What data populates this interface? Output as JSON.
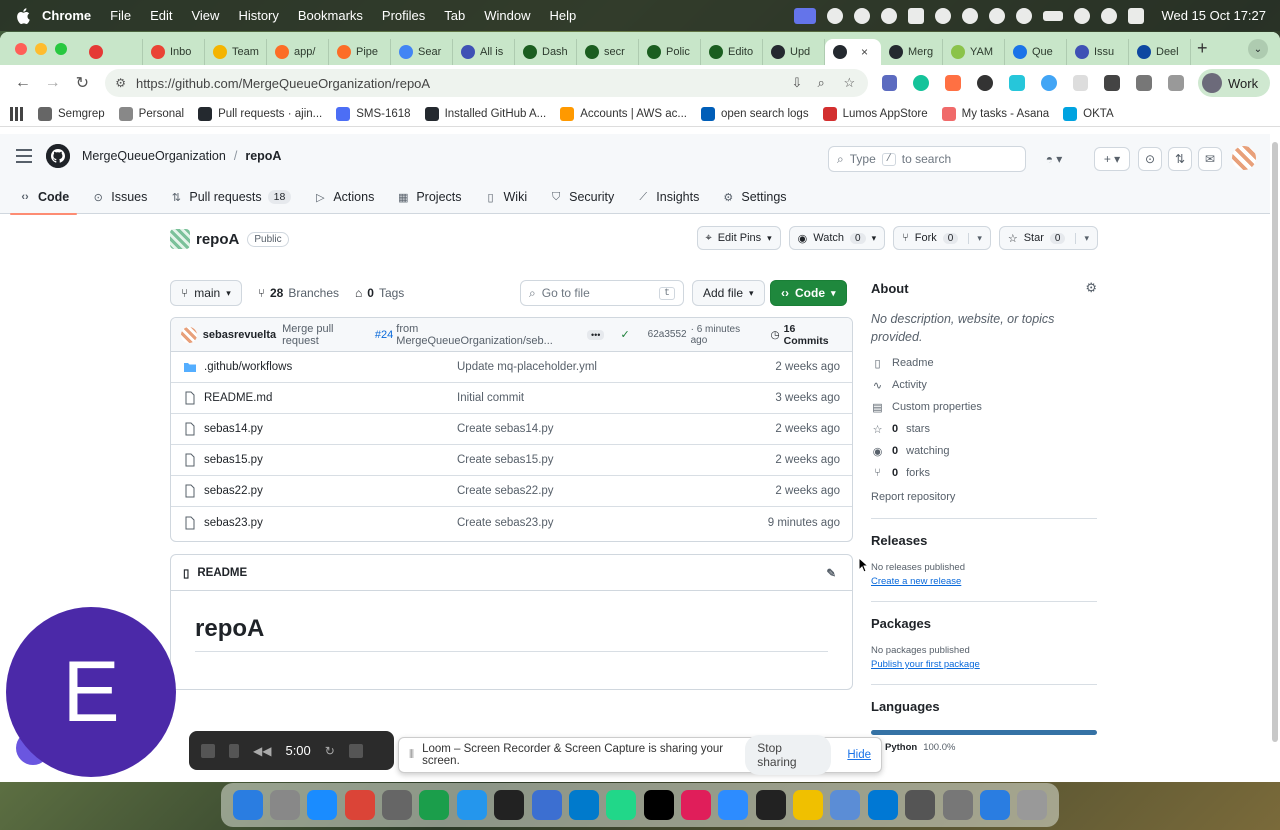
{
  "menubar": {
    "items": [
      "Chrome",
      "File",
      "Edit",
      "View",
      "History",
      "Bookmarks",
      "Profiles",
      "Tab",
      "Window",
      "Help"
    ],
    "clock": "Wed 15 Oct  17:27"
  },
  "tabs": [
    {
      "label": "",
      "color": "#e53935"
    },
    {
      "label": "Inbo",
      "color": "#ea4335"
    },
    {
      "label": "Team",
      "color": "#f4b400"
    },
    {
      "label": "app/",
      "color": "#fc6d26"
    },
    {
      "label": "Pipe",
      "color": "#fc6d26"
    },
    {
      "label": "Sear",
      "color": "#4285f4"
    },
    {
      "label": "All is",
      "color": "#3f51b5"
    },
    {
      "label": "Dash",
      "color": "#1b5e20"
    },
    {
      "label": "secr",
      "color": "#1b5e20"
    },
    {
      "label": "Polic",
      "color": "#1b5e20"
    },
    {
      "label": "Edito",
      "color": "#1b5e20"
    },
    {
      "label": "Upd",
      "color": "#24292f"
    },
    {
      "label": "",
      "color": "#24292f",
      "active": true
    },
    {
      "label": "Merg",
      "color": "#24292f"
    },
    {
      "label": "YAM",
      "color": "#8bc34a"
    },
    {
      "label": "Que",
      "color": "#1a73e8"
    },
    {
      "label": "Issu",
      "color": "#3f51b5"
    },
    {
      "label": "Deel",
      "color": "#0d47a1"
    }
  ],
  "browser": {
    "url": "https://github.com/MergeQueueOrganization/repoA",
    "profile": "Work"
  },
  "bookmarks": [
    {
      "label": "Semgrep",
      "color": "#666"
    },
    {
      "label": "Personal",
      "color": "#888"
    },
    {
      "label": "Pull requests · ajin...",
      "color": "#24292f"
    },
    {
      "label": "SMS-1618",
      "color": "#4c6ef5"
    },
    {
      "label": "Installed GitHub A...",
      "color": "#24292f"
    },
    {
      "label": "Accounts | AWS ac...",
      "color": "#ff9900"
    },
    {
      "label": "open search logs",
      "color": "#005eb8"
    },
    {
      "label": "Lumos AppStore",
      "color": "#d32f2f"
    },
    {
      "label": "My tasks - Asana",
      "color": "#f06a6a"
    },
    {
      "label": "OKTA",
      "color": "#00a3e0"
    }
  ],
  "github": {
    "org": "MergeQueueOrganization",
    "repo": "repoA",
    "search_placeholder_a": "Type",
    "search_key": "/",
    "search_placeholder_b": "to search",
    "nav": [
      {
        "label": "Code",
        "icon": "code-icon",
        "selected": true
      },
      {
        "label": "Issues",
        "icon": "issue-icon"
      },
      {
        "label": "Pull requests",
        "icon": "pull-request-icon",
        "count": "18"
      },
      {
        "label": "Actions",
        "icon": "play-icon"
      },
      {
        "label": "Projects",
        "icon": "table-icon"
      },
      {
        "label": "Wiki",
        "icon": "book-icon"
      },
      {
        "label": "Security",
        "icon": "shield-icon"
      },
      {
        "label": "Insights",
        "icon": "graph-icon"
      },
      {
        "label": "Settings",
        "icon": "gear-icon"
      }
    ],
    "visibility": "Public",
    "actions": {
      "edit_pins": "Edit Pins",
      "watch": "Watch",
      "watch_count": "0",
      "fork": "Fork",
      "fork_count": "0",
      "star": "Star",
      "star_count": "0"
    },
    "branch": "main",
    "branches_count": "28",
    "branches_label": "Branches",
    "tags_count": "0",
    "tags_label": "Tags",
    "go_to_file": "Go to file",
    "go_to_file_key": "t",
    "add_file": "Add file",
    "code_button": "Code",
    "commit": {
      "author": "sebasrevuelta",
      "msg_a": "Merge pull request",
      "pr": "#24",
      "msg_b": "from MergeQueueOrganization/seb...",
      "sha": "62a3552",
      "time": "· 6 minutes ago",
      "commits": "16 Commits"
    },
    "files": [
      {
        "name": ".github/workflows",
        "type": "dir",
        "msg": "Update mq-placeholder.yml",
        "date": "2 weeks ago"
      },
      {
        "name": "README.md",
        "type": "file",
        "msg": "Initial commit",
        "date": "3 weeks ago"
      },
      {
        "name": "sebas14.py",
        "type": "file",
        "msg": "Create sebas14.py",
        "date": "2 weeks ago"
      },
      {
        "name": "sebas15.py",
        "type": "file",
        "msg": "Create sebas15.py",
        "date": "2 weeks ago"
      },
      {
        "name": "sebas22.py",
        "type": "file",
        "msg": "Create sebas22.py",
        "date": "2 weeks ago"
      },
      {
        "name": "sebas23.py",
        "type": "file",
        "msg": "Create sebas23.py",
        "date": "9 minutes ago"
      }
    ],
    "readme_label": "README",
    "readme_heading": "repoA",
    "about": {
      "title": "About",
      "description": "No description, website, or topics provided.",
      "items": [
        {
          "icon": "book-icon",
          "bold": "",
          "label": "Readme"
        },
        {
          "icon": "pulse-icon",
          "bold": "",
          "label": "Activity"
        },
        {
          "icon": "note-icon",
          "bold": "",
          "label": "Custom properties"
        },
        {
          "icon": "star-icon",
          "bold": "0",
          "label": "stars"
        },
        {
          "icon": "eye-icon",
          "bold": "0",
          "label": "watching"
        },
        {
          "icon": "fork-icon",
          "bold": "0",
          "label": "forks"
        }
      ],
      "report": "Report repository",
      "releases_title": "Releases",
      "releases_none": "No releases published",
      "releases_link": "Create a new release",
      "packages_title": "Packages",
      "packages_none": "No packages published",
      "packages_link": "Publish your first package",
      "languages_title": "Languages",
      "language": "Python",
      "language_pct": "100.0%"
    }
  },
  "loom": {
    "bubble_letter": "E",
    "timer": "5:00",
    "share_text": "Loom – Screen Recorder & Screen Capture is sharing your screen.",
    "stop": "Stop sharing",
    "hide": "Hide"
  },
  "dock": [
    "#2a7de1",
    "#888",
    "#1a8cff",
    "#db4437",
    "#666",
    "#1b9e4b",
    "#2496ed",
    "#222",
    "#3c6fd1",
    "#007acc",
    "#21d789",
    "#000",
    "#e01e5a",
    "#2d8cff",
    "#222",
    "#f0c000",
    "#5b8dd6",
    "#0078d4",
    "#555",
    "#777",
    "#2a7de1",
    "#999"
  ]
}
